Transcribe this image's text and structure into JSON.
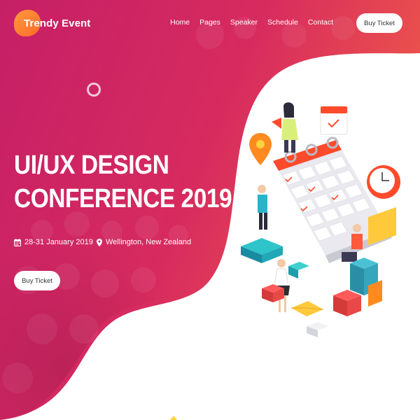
{
  "brand": {
    "name": "Trendy Event"
  },
  "nav": {
    "links": [
      "Home",
      "Pages",
      "Speaker",
      "Schedule",
      "Contact"
    ],
    "cta_label": "Buy Ticket"
  },
  "hero": {
    "title_line1": "UI/UX DESIGN",
    "title_line2": "CONFERENCE 2019",
    "date": "28-31 January 2019",
    "location": "Wellington, New Zealand",
    "cta_label": "Buy Ticket"
  },
  "icons": {
    "date": "calendar-icon",
    "location": "map-pin-icon"
  },
  "colors": {
    "gradient_start": "#c8236a",
    "gradient_end": "#f05a4a",
    "accent_orange": "#ff7a2b",
    "accent_yellow": "#ffd23f"
  }
}
